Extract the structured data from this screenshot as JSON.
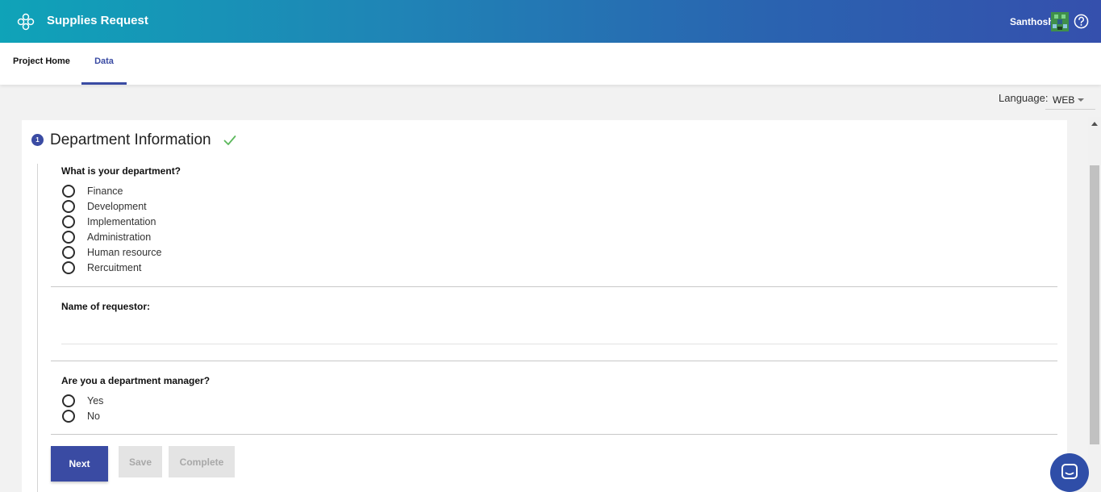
{
  "header": {
    "app_title": "Supplies Request",
    "logo_icon": "flower-logo-icon",
    "user_name": "Santhosh",
    "help_icon": "question-circle-icon",
    "gradient_start": "#0fa3b8",
    "gradient_end": "#3550ad"
  },
  "tabs": [
    {
      "label": "Project Home",
      "active": false
    },
    {
      "label": "Data",
      "active": true
    }
  ],
  "language": {
    "label": "Language:",
    "value": "WEB"
  },
  "section": {
    "step_number": "1",
    "title": "Department Information",
    "status_icon": "checkmark-icon",
    "status_color": "#5cb85c"
  },
  "questions": {
    "department": {
      "label": "What is your department?",
      "options": [
        "Finance",
        "Development",
        "Implementation",
        "Administration",
        "Human resource",
        "Rercuitment"
      ]
    },
    "requestor": {
      "label": "Name of requestor:",
      "value": ""
    },
    "manager": {
      "label": "Are you a department manager?",
      "options": [
        "Yes",
        "No"
      ]
    }
  },
  "buttons": {
    "next": "Next",
    "save": "Save",
    "complete": "Complete"
  },
  "accent_color": "#3a4ba3",
  "chat_icon": "chat-bubble-icon"
}
